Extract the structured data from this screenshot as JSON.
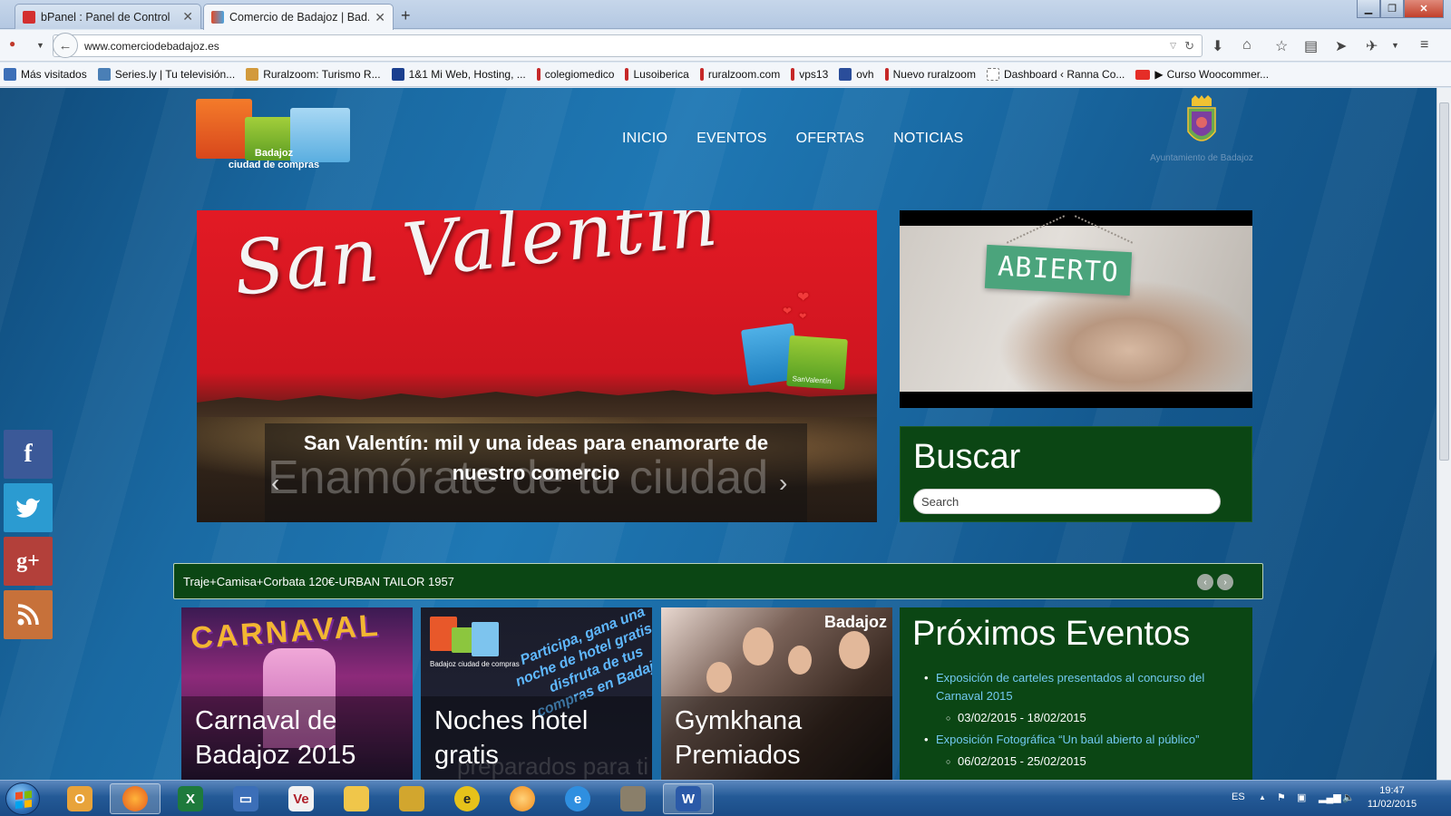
{
  "browser": {
    "tabs": [
      {
        "title": "bPanel : Panel de Control",
        "active": false
      },
      {
        "title": "Comercio de Badajoz | Bad...",
        "active": true
      }
    ],
    "new_tab_icon": "plus-icon",
    "url": "www.comerciodebadajoz.es",
    "bookmarks": [
      {
        "label": "Más visitados",
        "color": "#3c6fb8"
      },
      {
        "label": "Series.ly | Tu televisión...",
        "color": "#4a7fb6"
      },
      {
        "label": "Ruralzoom: Turismo R...",
        "color": "#d29a3c"
      },
      {
        "label": "1&1 Mi Web, Hosting, ...",
        "color": "#1b3f8f"
      },
      {
        "label": "colegiomedico",
        "color": "#c62828"
      },
      {
        "label": "Lusoiberica",
        "color": "#c62828"
      },
      {
        "label": "ruralzoom.com",
        "color": "#c62828"
      },
      {
        "label": "vps13",
        "color": "#c62828"
      },
      {
        "label": "ovh",
        "color": "#2a4d9a"
      },
      {
        "label": "Nuevo ruralzoom",
        "color": "#c62828"
      },
      {
        "label": "Dashboard ‹ Ranna Co...",
        "color": "#ffffff"
      },
      {
        "label": "Curso Woocommer...",
        "color": "#e52d27"
      }
    ]
  },
  "site": {
    "logo_line1": "Badajoz",
    "logo_line2": "ciudad de compras",
    "nav": [
      "INICIO",
      "EVENTOS",
      "OFERTAS",
      "NOTICIAS"
    ],
    "ayuntamiento": "Ayuntamiento de Badajoz",
    "hero": {
      "script_title": "San Valentín",
      "bag_label": "SanValentín",
      "caption": "San Valentín: mil y una ideas para enamorarte de nuestro comercio",
      "watermark": "Enamórate de tu ciudad"
    },
    "video_sign": "ABIERTO",
    "search": {
      "title": "Buscar",
      "placeholder": "Search"
    },
    "social": [
      {
        "label": "f",
        "color": "#3b5998"
      },
      {
        "label": "twitter",
        "color": "#2b9bd1"
      },
      {
        "label": "g+",
        "color": "#b3403a"
      },
      {
        "label": "rss",
        "color": "#c7713a"
      }
    ],
    "ticker": "Traje+Camisa+Corbata 120€-URBAN TAILOR 1957",
    "cards": [
      {
        "title": "Carnaval de Badajoz 2015",
        "art": "CARNAVAL"
      },
      {
        "title": "Noches hotel gratis",
        "art": "Participa, gana una noche de hotel gratis y disfruta de tus compras en Badajoz",
        "logo": "Badajoz ciudad de compras",
        "overlay": "preparados para ti"
      },
      {
        "title": "Gymkhana Premiados",
        "brand": "Badajoz"
      }
    ],
    "events": {
      "title": "Próximos Eventos",
      "items": [
        {
          "name": "Exposición de carteles presentados al concurso del Carnaval 2015",
          "dates": "03/02/2015 - 18/02/2015"
        },
        {
          "name": "Exposición Fotográfica “Un baúl abierto al público”",
          "dates": "06/02/2015 - 25/02/2015"
        }
      ]
    }
  },
  "taskbar": {
    "language": "ES",
    "time": "19:47",
    "date": "11/02/2015"
  }
}
